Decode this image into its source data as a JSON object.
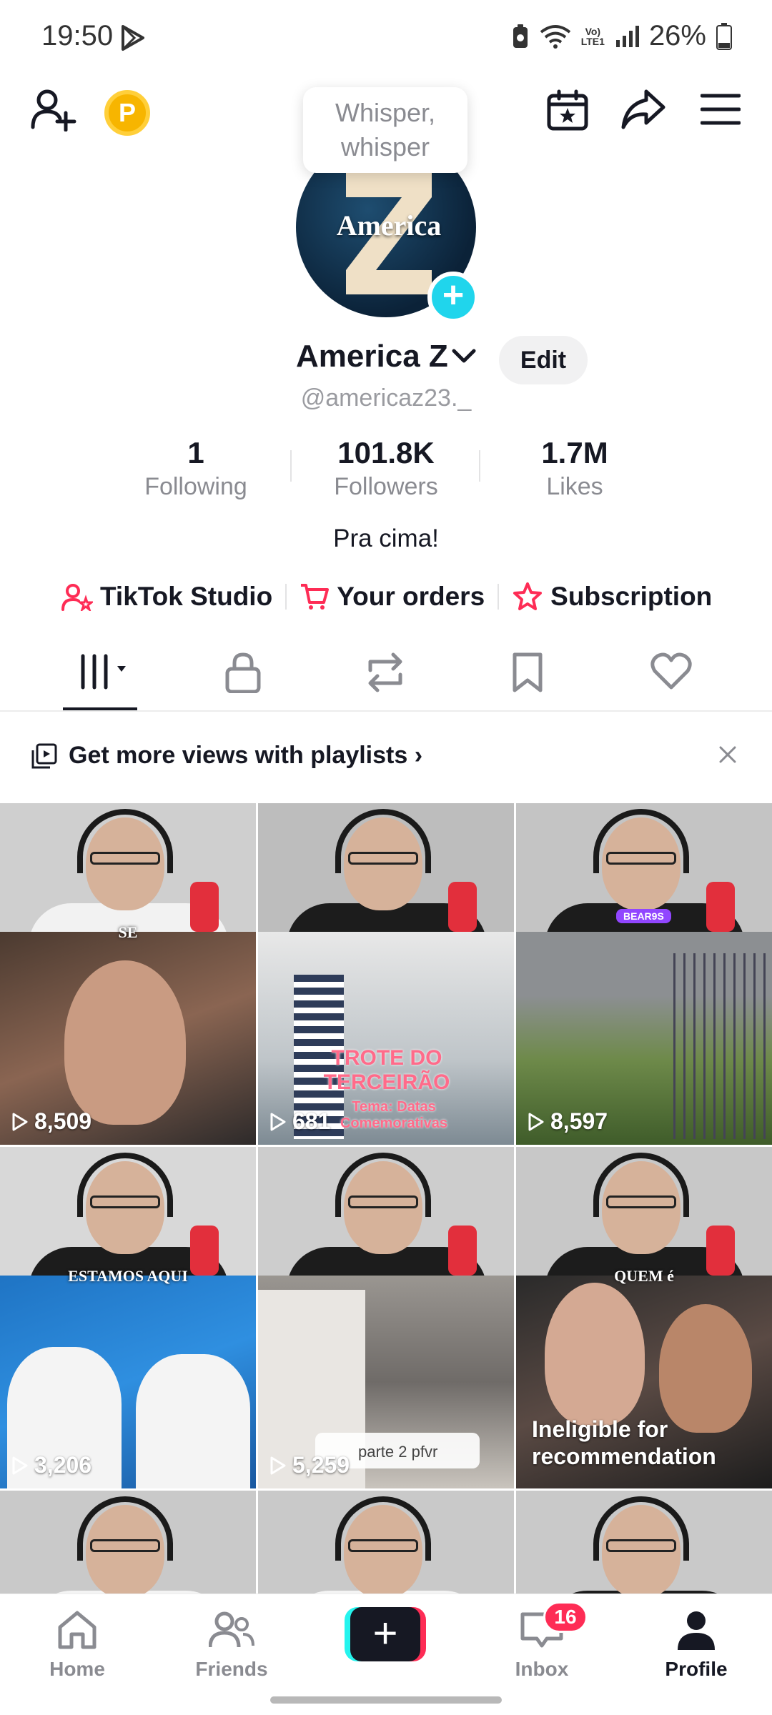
{
  "status_bar": {
    "time": "19:50",
    "lte_line1": "Vo)",
    "lte_line2": "LTE1",
    "battery": "26%"
  },
  "header": {
    "coin_letter": "P",
    "whisper_line1": "Whisper,",
    "whisper_line2": "whisper"
  },
  "profile": {
    "avatar_text": "America",
    "name": "America Z",
    "edit_label": "Edit",
    "handle": "@americaz23._",
    "stats": [
      {
        "value": "1",
        "label": "Following"
      },
      {
        "value": "101.8K",
        "label": "Followers"
      },
      {
        "value": "1.7M",
        "label": "Likes"
      }
    ],
    "bio": "Pra cima!"
  },
  "links": {
    "studio": "TikTok Studio",
    "orders": "Your orders",
    "subscription": "Subscription"
  },
  "colors": {
    "accent": "#fe2c55",
    "teal": "#25f4ee",
    "plus": "#20d5ec"
  },
  "playlist_banner": {
    "text": "Get more views with playlists"
  },
  "videos": [
    {
      "views": "8,509",
      "caption": "SE"
    },
    {
      "views": "681",
      "overlay1": "TROTE DO",
      "overlay2": "TERCEIRÃO",
      "overlay3": "Tema: Datas",
      "overlay4": "Comemorativas"
    },
    {
      "views": "8,597",
      "badge": "BEAR9S"
    },
    {
      "views": "3,206",
      "caption": "ESTAMOS AQUI"
    },
    {
      "views": "5,259",
      "comment": "parte 2 pfvr"
    },
    {
      "status_line1": "Ineligible for",
      "status_line2": "recommendation",
      "caption": "QUEM é"
    }
  ],
  "bottom_nav": {
    "home": "Home",
    "friends": "Friends",
    "inbox": "Inbox",
    "inbox_badge": "16",
    "profile": "Profile"
  }
}
